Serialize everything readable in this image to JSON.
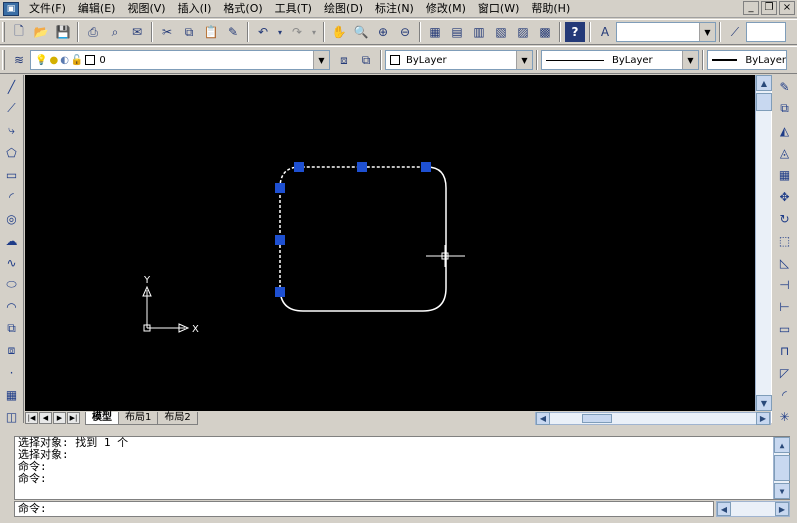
{
  "menu": {
    "items": [
      "文件(F)",
      "编辑(E)",
      "视图(V)",
      "插入(I)",
      "格式(O)",
      "工具(T)",
      "绘图(D)",
      "标注(N)",
      "修改(M)",
      "窗口(W)",
      "帮助(H)"
    ]
  },
  "layers": {
    "current_layer": "0"
  },
  "properties": {
    "color": "ByLayer",
    "linetype": "ByLayer",
    "lineweight": "ByLayer"
  },
  "ucs": {
    "x_label": "X",
    "y_label": "Y"
  },
  "tabs": [
    "模型",
    "布局1",
    "布局2"
  ],
  "command": {
    "history": [
      "选择对象: 找到 1 个",
      "选择对象:",
      "命令:",
      "命令:"
    ],
    "prompt": "命令:"
  },
  "colors": {
    "canvas": "#000000",
    "grip": "#1e50d2",
    "geometry": "#ffffff"
  }
}
